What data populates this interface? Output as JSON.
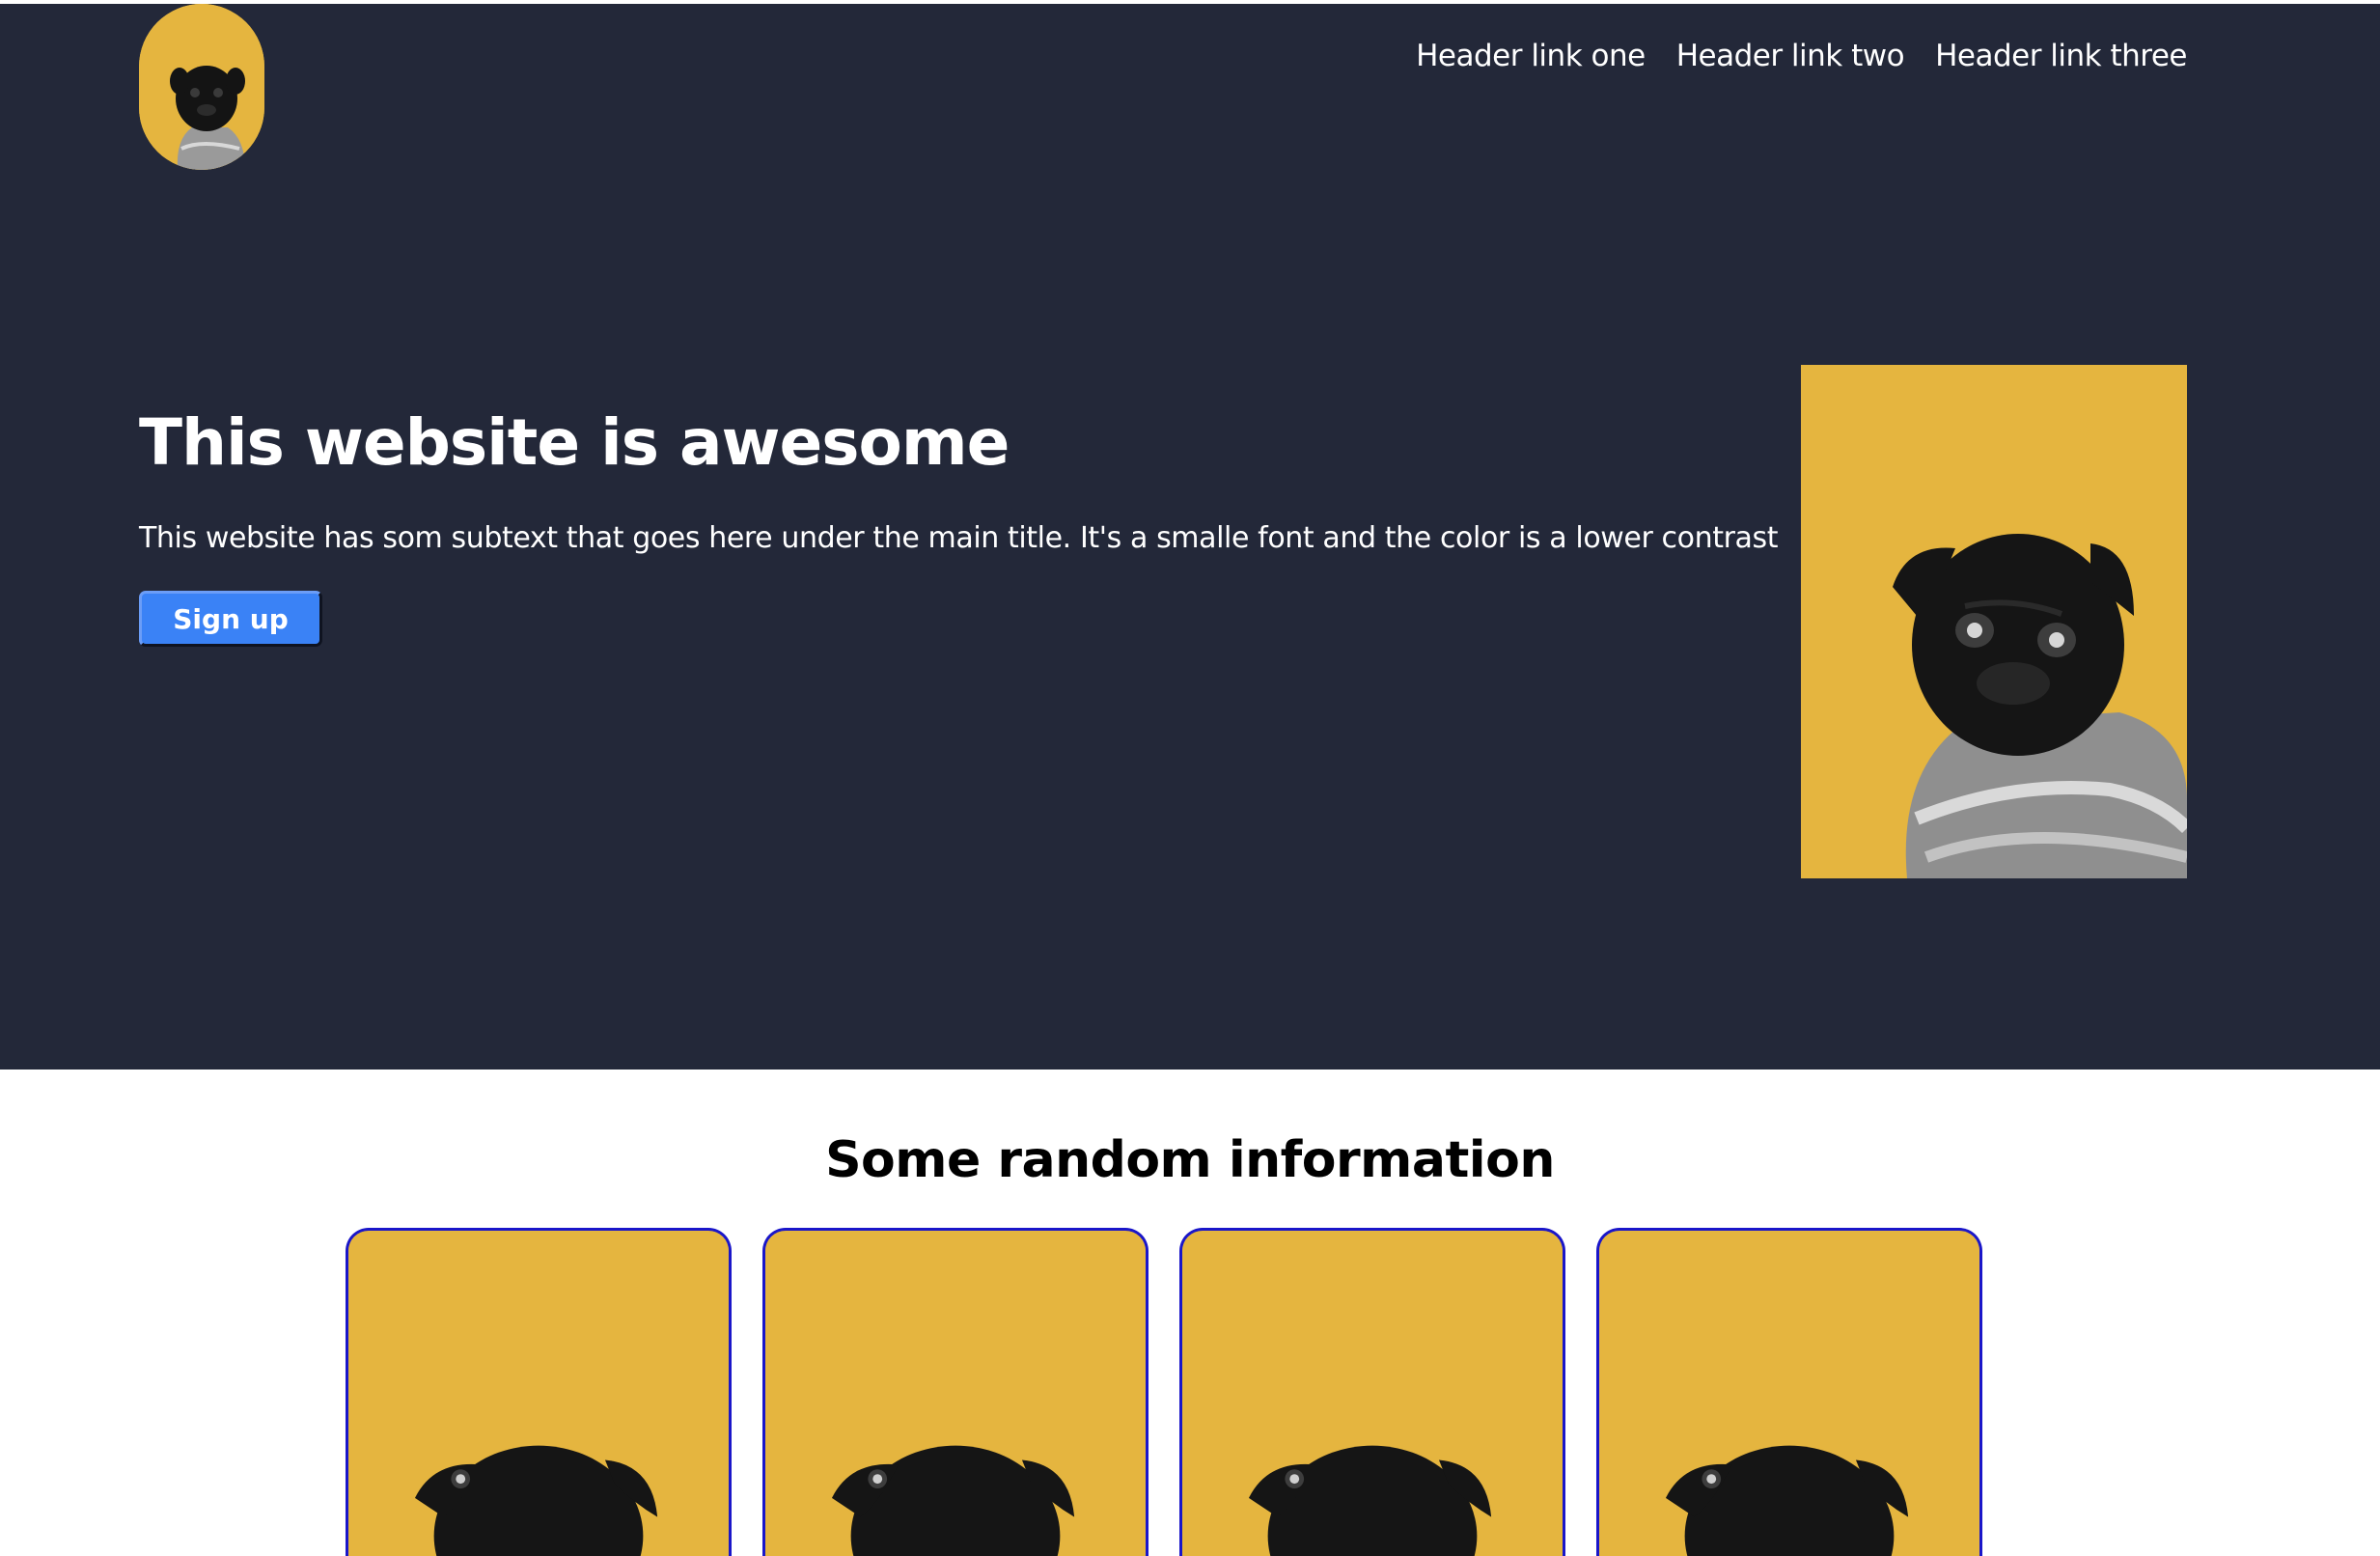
{
  "header": {
    "logo_alt": "pug logo",
    "links": [
      "Header link one",
      "Header link two",
      "Header link three"
    ]
  },
  "hero": {
    "title": "This website is awesome",
    "subtext": "This website has som subtext that goes here under the main title. It's a smalle font and the color is a lower contrast",
    "cta_label": "Sign up"
  },
  "info": {
    "title": "Some random information",
    "cards": [
      {
        "image": "pug-photo"
      },
      {
        "image": "pug-photo"
      },
      {
        "image": "pug-photo"
      },
      {
        "image": "pug-photo"
      }
    ]
  },
  "colors": {
    "hero_bg": "#232839",
    "accent_yellow": "#e5b53f",
    "button_blue": "#3a82f6",
    "card_border": "#1a16c9"
  }
}
